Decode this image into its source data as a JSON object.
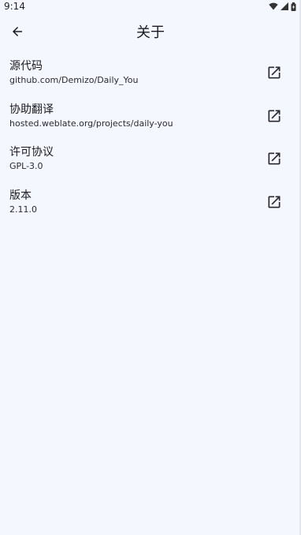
{
  "status_bar": {
    "time": "9:14",
    "icons": [
      "wifi-icon",
      "signal-icon",
      "battery-icon"
    ]
  },
  "app_bar": {
    "title": "关于",
    "back_icon": "arrow-left-icon"
  },
  "items": [
    {
      "title": "源代码",
      "subtitle": "github.com/Demizo/Daily_You",
      "icon": "open-in-new-icon"
    },
    {
      "title": "协助翻译",
      "subtitle": "hosted.weblate.org/projects/daily-you",
      "icon": "open-in-new-icon"
    },
    {
      "title": "许可协议",
      "subtitle": "GPL-3.0",
      "icon": "open-in-new-icon"
    },
    {
      "title": "版本",
      "subtitle": "2.11.0",
      "icon": "open-in-new-icon"
    }
  ],
  "colors": {
    "background": "#f4f7fe",
    "text": "#1b1b1f"
  }
}
